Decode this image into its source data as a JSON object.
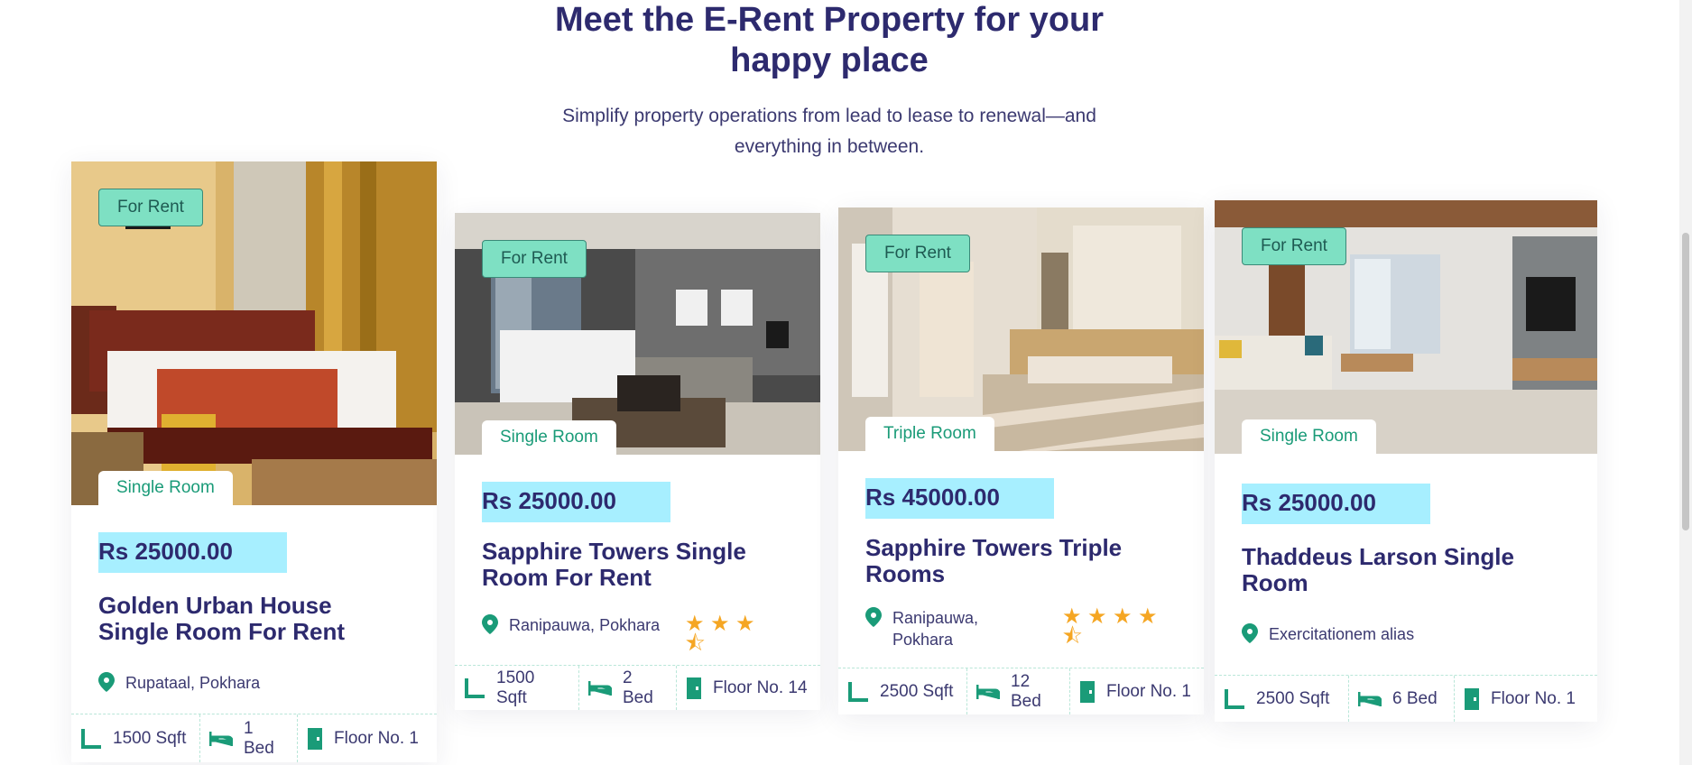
{
  "section": {
    "title": "Meet the E-Rent Property for your happy place",
    "subtitle": "Simplify property operations from lead to lease to renewal—and everything in between."
  },
  "cards": [
    {
      "status": "For Rent",
      "room_type": "Single Room",
      "price": "Rs 25000.00",
      "title": "Golden Urban House Single Room For Rent",
      "location": "Rupataal, Pokhara",
      "rating": null,
      "area": "1500 Sqft",
      "beds": "1 Bed",
      "floor": "Floor No. 1"
    },
    {
      "status": "For Rent",
      "room_type": "Single Room",
      "price": "Rs 25000.00",
      "title": "Sapphire Towers Single Room For Rent",
      "location": "Ranipauwa, Pokhara",
      "rating": 3.5,
      "area": "1500 Sqft",
      "beds": "2 Bed",
      "floor": "Floor No. 14"
    },
    {
      "status": "For Rent",
      "room_type": "Triple Room",
      "price": "Rs 45000.00",
      "title": "Sapphire Towers Triple Rooms",
      "location": "Ranipauwa, Pokhara",
      "rating": 4.5,
      "area": "2500 Sqft",
      "beds": "12 Bed",
      "floor": "Floor No. 1"
    },
    {
      "status": "For Rent",
      "room_type": "Single Room",
      "price": "Rs 25000.00",
      "title": "Thaddeus Larson Single Room",
      "location": "Exercitationem alias",
      "rating": null,
      "area": "2500 Sqft",
      "beds": "6 Bed",
      "floor": "Floor No. 1"
    }
  ],
  "colors": {
    "accent_green": "#1a9b78",
    "badge_bg": "#7ee0c3",
    "price_bg": "#a7efff",
    "heading": "#2d2a6e",
    "star": "#f5a623"
  }
}
